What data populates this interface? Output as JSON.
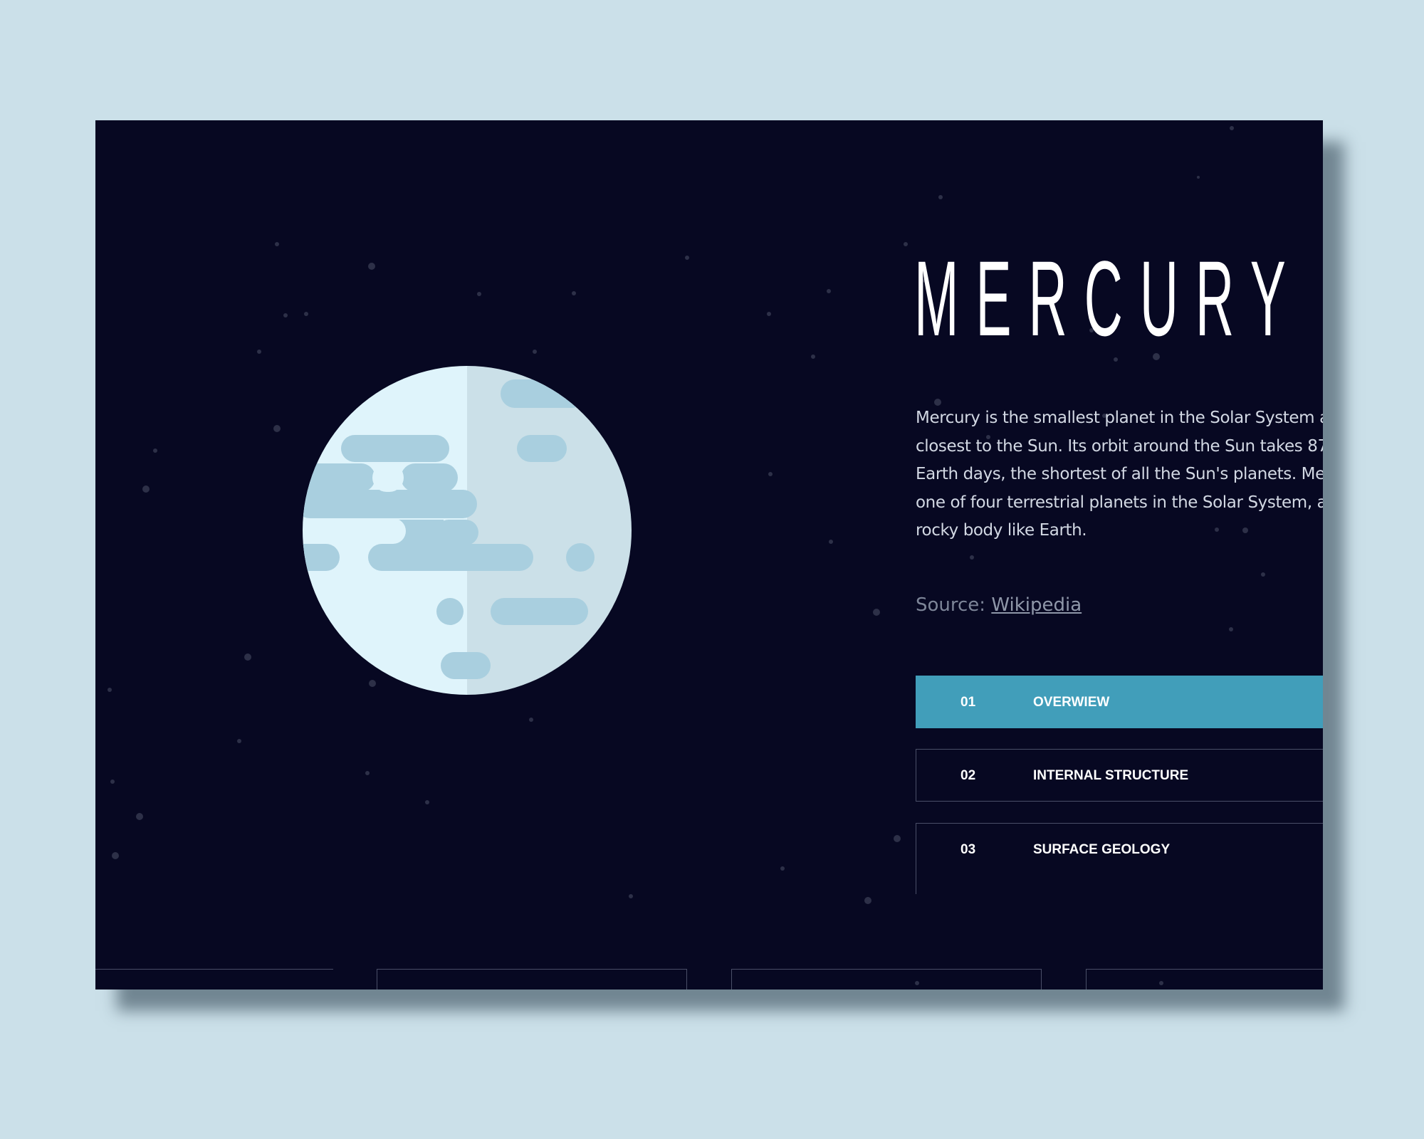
{
  "planet": {
    "name": "MERCURY",
    "description": "Mercury is the smallest planet in the Solar System and the closest to the Sun. Its orbit around the Sun takes 87.97 Earth days, the shortest of all the Sun's planets. Mercury is one of four terrestrial planets in the Solar System, and is a rocky body like Earth.",
    "source_label": "Source:",
    "source_link": "Wikipedia",
    "icon": "planet-mercury-icon"
  },
  "tabs": [
    {
      "number": "01",
      "label": "OVERWIEW",
      "active": true
    },
    {
      "number": "02",
      "label": "INTERNAL STRUCTURE",
      "active": false
    },
    {
      "number": "03",
      "label": "SURFACE GEOLOGY",
      "active": false
    }
  ],
  "colors": {
    "background": "#cbe0e9",
    "space": "#070822",
    "accent": "#419eba",
    "planet_light": "#dff4fb",
    "planet_shade": "#cbe0e8",
    "planet_spots": "#a9cfdf"
  }
}
